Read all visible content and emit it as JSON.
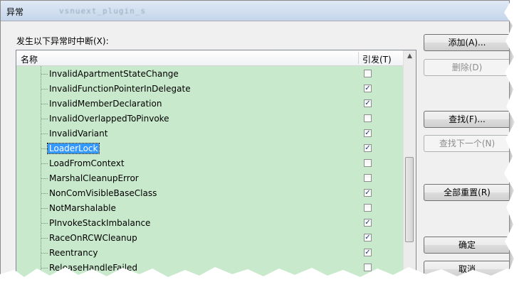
{
  "window": {
    "title": "异常",
    "title_obscured": "vsnuext_plugin_s"
  },
  "prompt_label": "发生以下异常时中断(X):",
  "list": {
    "header_name": "名称",
    "header_raise": "引发(T)",
    "rows": [
      {
        "label": "InvalidApartmentStateChange",
        "checked": false
      },
      {
        "label": "InvalidFunctionPointerInDelegate",
        "checked": true
      },
      {
        "label": "InvalidMemberDeclaration",
        "checked": true
      },
      {
        "label": "InvalidOverlappedToPinvoke",
        "checked": false
      },
      {
        "label": "InvalidVariant",
        "checked": true
      },
      {
        "label": "LoaderLock",
        "checked": true,
        "selected": true
      },
      {
        "label": "LoadFromContext",
        "checked": false
      },
      {
        "label": "MarshalCleanupError",
        "checked": false
      },
      {
        "label": "NonComVisibleBaseClass",
        "checked": true
      },
      {
        "label": "NotMarshalable",
        "checked": false
      },
      {
        "label": "PInvokeStackImbalance",
        "checked": true
      },
      {
        "label": "RaceOnRCWCleanup",
        "checked": true
      },
      {
        "label": "Reentrancy",
        "checked": true
      },
      {
        "label": "ReleaseHandleFailed",
        "checked": false
      }
    ]
  },
  "buttons": {
    "add": "添加(A)...",
    "delete": "删除(D)",
    "find": "查找(F)...",
    "find_next": "查找下一个(N)",
    "reset_all": "全部重置(R)",
    "ok": "确定",
    "cancel": "取消"
  },
  "colors": {
    "list_bg": "#c9e9cc",
    "selection": "#3399ff"
  },
  "icons": {
    "scroll_up": "▲",
    "scroll_down": "▼",
    "check": "✓"
  }
}
